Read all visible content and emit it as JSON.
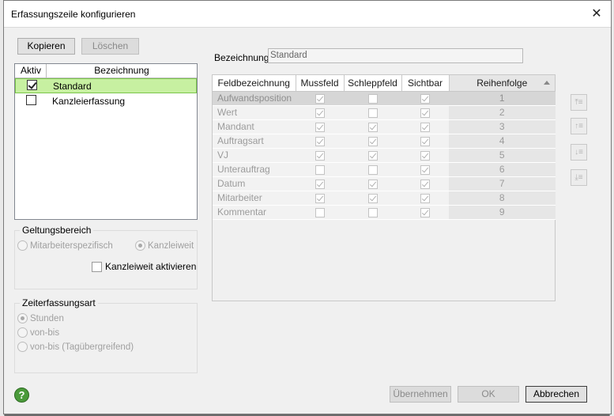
{
  "window": {
    "title": "Erfassungszeile konfigurieren",
    "close_glyph": "✕"
  },
  "toolbar": {
    "copy_label": "Kopieren",
    "delete_label": "Löschen"
  },
  "list": {
    "headers": {
      "active": "Aktiv",
      "name": "Bezeichnung"
    },
    "rows": [
      {
        "label": "Standard",
        "checked": true,
        "selected": true
      },
      {
        "label": "Kanzleierfassung",
        "checked": false,
        "selected": false
      }
    ]
  },
  "scope": {
    "title": "Geltungsbereich",
    "option_user": "Mitarbeiterspezifisch",
    "option_firm": "Kanzleiweit",
    "activate_label": "Kanzleiweit aktivieren"
  },
  "time_type": {
    "title": "Zeiterfassungsart",
    "options": [
      "Stunden",
      "von-bis",
      "von-bis (Tagübergreifend)"
    ]
  },
  "name_field": {
    "label": "Bezeichnung:",
    "value": "Standard"
  },
  "grid": {
    "headers": [
      "Feldbezeichnung",
      "Mussfeld",
      "Schleppfeld",
      "Sichtbar",
      "Reihenfolge"
    ],
    "rows": [
      {
        "name": "Aufwandsposition",
        "muss": true,
        "schlepp": false,
        "sicht": true,
        "order": "1"
      },
      {
        "name": "Wert",
        "muss": true,
        "schlepp": false,
        "sicht": true,
        "order": "2"
      },
      {
        "name": "Mandant",
        "muss": true,
        "schlepp": true,
        "sicht": true,
        "order": "3"
      },
      {
        "name": "Auftragsart",
        "muss": true,
        "schlepp": true,
        "sicht": true,
        "order": "4"
      },
      {
        "name": "VJ",
        "muss": true,
        "schlepp": true,
        "sicht": true,
        "order": "5"
      },
      {
        "name": "Unterauftrag",
        "muss": false,
        "schlepp": false,
        "sicht": true,
        "order": "6"
      },
      {
        "name": "Datum",
        "muss": true,
        "schlepp": true,
        "sicht": true,
        "order": "7"
      },
      {
        "name": "Mitarbeiter",
        "muss": true,
        "schlepp": true,
        "sicht": true,
        "order": "8"
      },
      {
        "name": "Kommentar",
        "muss": false,
        "schlepp": false,
        "sicht": true,
        "order": "9"
      }
    ]
  },
  "move_buttons": [
    "move-top-icon",
    "move-up-icon",
    "move-down-icon",
    "move-bottom-icon"
  ],
  "footer": {
    "apply_label": "Übernehmen",
    "ok_label": "OK",
    "cancel_label": "Abbrechen",
    "help_glyph": "?"
  },
  "colors": {
    "selection": "#c7f0a1",
    "selection_border": "#7ac64a",
    "help": "#4a9a3a"
  }
}
